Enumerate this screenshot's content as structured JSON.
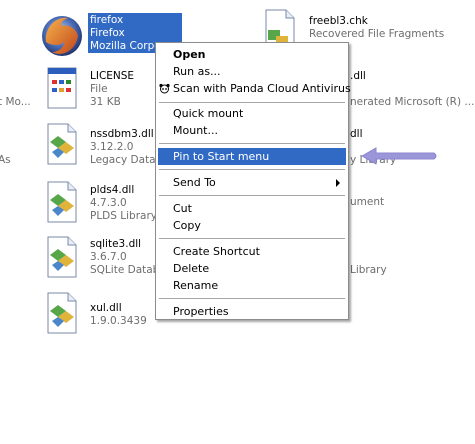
{
  "files": {
    "firefox": {
      "name": "firefox",
      "line1": "Firefox",
      "line2": "Mozilla Corpo"
    },
    "freebl3": {
      "name": "freebl3.chk",
      "line1": "Recovered File Fragments"
    },
    "license": {
      "name": "LICENSE",
      "line1": "File",
      "line2": "31 KB"
    },
    "nssdbm3": {
      "name": "nssdbm3.dll",
      "line1": "3.12.2.0",
      "line2": "Legacy Datab"
    },
    "plds4": {
      "name": "plds4.dll",
      "line1": "4.7.3.0",
      "line2": "PLDS Library"
    },
    "sqlite3": {
      "name": "sqlite3.dll",
      "line1": "3.6.7.0",
      "line2": "SQLite Datab"
    },
    "xul": {
      "name": "xul.dll",
      "line1": "1.9.0.3439"
    }
  },
  "partials": {
    "left_mo": "t Mo...",
    "left_as": "As",
    "right_dll": ".dll",
    "right_generated": "nerated Microsoft (R) ...",
    "right_dll2": "dll",
    "right_library": "y Library",
    "right_ument": "ument",
    "right_library2": "Library"
  },
  "context_menu": {
    "open": "Open",
    "run_as": "Run as...",
    "scan": "Scan with Panda Cloud Antivirus",
    "quick_mount": "Quick mount",
    "mount": "Mount...",
    "pin_start": "Pin to Start menu",
    "send_to": "Send To",
    "cut": "Cut",
    "copy": "Copy",
    "create_shortcut": "Create Shortcut",
    "delete": "Delete",
    "rename": "Rename",
    "properties": "Properties"
  },
  "colors": {
    "highlight": "#316ac5",
    "annotation_arrow": "#9b96d9"
  }
}
